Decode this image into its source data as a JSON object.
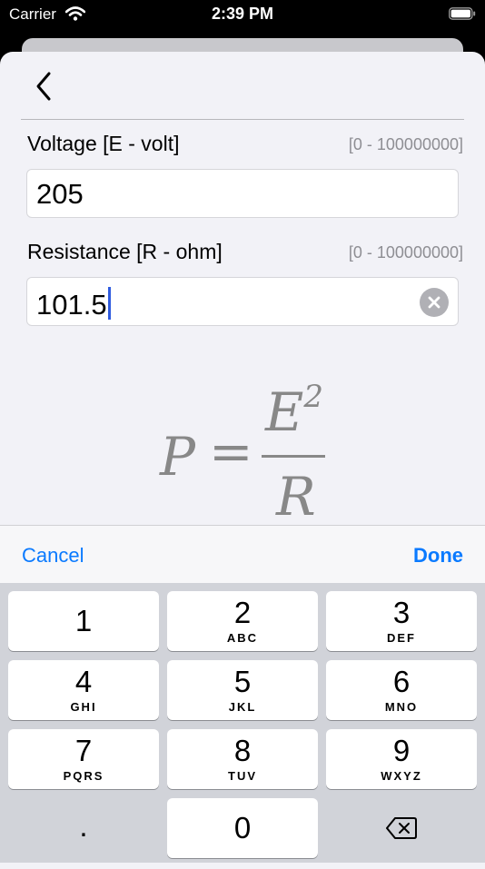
{
  "status": {
    "carrier": "Carrier",
    "time": "2:39 PM"
  },
  "fields": [
    {
      "label": "Voltage [E - volt]",
      "range": "[0 - 100000000]",
      "value": "205"
    },
    {
      "label": "Resistance [R - ohm]",
      "range": "[0 - 100000000]",
      "value": "101.5"
    }
  ],
  "formula": {
    "lhs": "P",
    "eq": "=",
    "numerator": "E",
    "exponent": "2",
    "denominator": "R"
  },
  "toolbar": {
    "cancel": "Cancel",
    "done": "Done"
  },
  "keypad": {
    "k1": {
      "digit": "1",
      "letters": ""
    },
    "k2": {
      "digit": "2",
      "letters": "ABC"
    },
    "k3": {
      "digit": "3",
      "letters": "DEF"
    },
    "k4": {
      "digit": "4",
      "letters": "GHI"
    },
    "k5": {
      "digit": "5",
      "letters": "JKL"
    },
    "k6": {
      "digit": "6",
      "letters": "MNO"
    },
    "k7": {
      "digit": "7",
      "letters": "PQRS"
    },
    "k8": {
      "digit": "8",
      "letters": "TUV"
    },
    "k9": {
      "digit": "9",
      "letters": "WXYZ"
    },
    "dot": ".",
    "k0": "0"
  },
  "colors": {
    "accent": "#0a7aff",
    "cursor": "#2f5bdf",
    "sheet": "#f2f2f7",
    "keyboard": "#d1d3d9"
  },
  "icons": {
    "back": "chevron-left-icon",
    "clear": "clear-circle-icon",
    "delete": "backspace-icon",
    "wifi": "wifi-icon",
    "battery": "battery-icon"
  }
}
